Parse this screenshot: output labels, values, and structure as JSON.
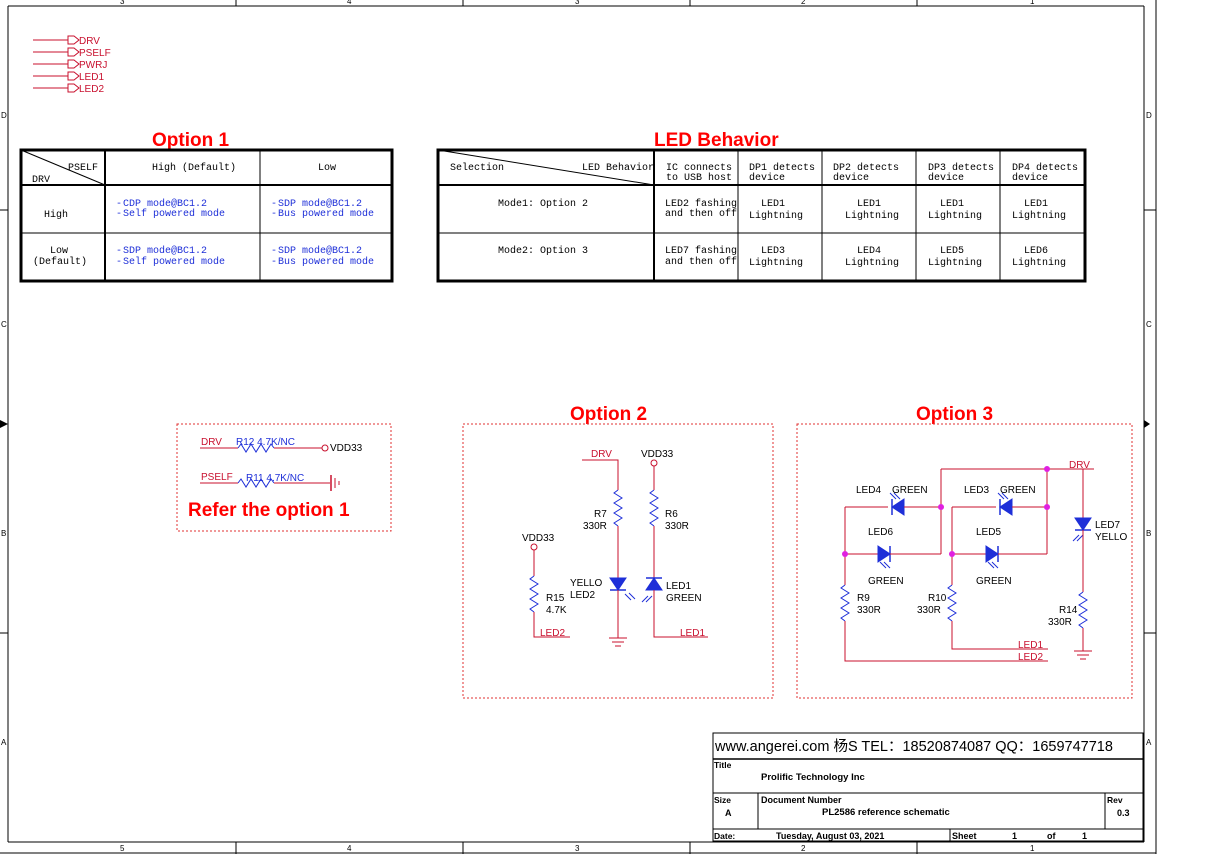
{
  "border": {
    "cols_top": [
      "3",
      "4",
      "3",
      "2",
      "1"
    ],
    "cols_bottom": [
      "5",
      "4",
      "3",
      "2",
      "1"
    ],
    "rows": [
      "D",
      "C",
      "B",
      "A"
    ]
  },
  "nets": [
    "DRV",
    "PSELF",
    "PWRJ",
    "LED1",
    "LED2"
  ],
  "option1": {
    "title": "Option 1",
    "corner_top": "PSELF",
    "corner_bottom": "DRV",
    "col_high": "High (Default)",
    "col_low": "Low",
    "row1_label": "High",
    "row1_c1_l1": "CDP mode@BC1.2",
    "row1_c1_l2": "Self powered mode",
    "row1_c2_l1": "SDP mode@BC1.2",
    "row1_c2_l2": "Bus powered mode",
    "row2_label_l1": "Low",
    "row2_label_l2": "(Default)",
    "row2_c1_l1": "SDP mode@BC1.2",
    "row2_c1_l2": "Self powered mode",
    "row2_c2_l1": "SDP mode@BC1.2",
    "row2_c2_l2": "Bus powered mode"
  },
  "led_behavior": {
    "title": "LED Behavior",
    "corner_left": "Selection",
    "corner_right": "LED Behavior",
    "h1_l1": "IC connects",
    "h1_l2": "to USB host",
    "h2_l1": "DP1 detects",
    "h2_l2": "device",
    "h3_l1": "DP2 detects",
    "h3_l2": "device",
    "h4_l1": "DP3 detects",
    "h4_l2": "device",
    "h5_l1": "DP4 detects",
    "h5_l2": "device",
    "m1_label": "Mode1: Option 2",
    "m1_c1_l1": "LED2 fashing",
    "m1_c1_l2": "and then off",
    "m1_c2_l1": "LED1",
    "m1_c3_l1": "LED1",
    "m1_c4_l1": "LED1",
    "m1_c5_l1": "LED1",
    "m2_label": "Mode2: Option 3",
    "m2_c1_l1": "LED7 fashing",
    "m2_c1_l2": "and then off",
    "m2_c2_l1": "LED3",
    "m2_c3_l1": "LED4",
    "m2_c4_l1": "LED5",
    "m2_c5_l1": "LED6",
    "lightning": "Lightning"
  },
  "refer": {
    "drv": "DRV",
    "r12": "R12 4.7K/NC",
    "vdd": "VDD33",
    "pself": "PSELF",
    "r11": "R11 4.7K/NC",
    "note": "Refer the option 1"
  },
  "option2": {
    "title": "Option 2",
    "drv": "DRV",
    "vdd_top": "VDD33",
    "r7": "R7",
    "r7v": "330R",
    "r6": "R6",
    "r6v": "330R",
    "vdd_left": "VDD33",
    "r15": "R15",
    "r15v": "4.7K",
    "yello": "YELLO",
    "led2": "LED2",
    "led1_lbl": "LED1",
    "green": "GREEN",
    "net_led2": "LED2",
    "net_led1": "LED1"
  },
  "option3": {
    "title": "Option 3",
    "drv": "DRV",
    "led4": "LED4",
    "green4": "GREEN",
    "led3": "LED3",
    "green3": "GREEN",
    "led6": "LED6",
    "green6": "GREEN",
    "led5": "LED5",
    "green5": "GREEN",
    "led7": "LED7",
    "yello7": "YELLO",
    "r9": "R9",
    "r9v": "330R",
    "r10": "R10",
    "r10v": "330R",
    "r14": "R14",
    "r14v": "330R",
    "net_led1": "LED1",
    "net_led2": "LED2"
  },
  "titleblock": {
    "banner": "www.angerei.com 杨S TEL：18520874087  QQ：1659747718",
    "title_label": "Title",
    "company": "Prolific Technology Inc",
    "size_label": "Size",
    "size": "A",
    "docnum_label": "Document Number",
    "docnum": "PL2586 reference schematic",
    "rev_label": "Rev",
    "rev": "0.3",
    "date_label": "Date:",
    "date": "Tuesday, August 03, 2021",
    "sheet_label": "Sheet",
    "sheet": "1",
    "of_label": "of",
    "sheet_total": "1"
  },
  "colors": {
    "wire": "#c8102e",
    "component": "#1e2fd8",
    "title": "#ff0000",
    "junction": "#e020e0"
  }
}
